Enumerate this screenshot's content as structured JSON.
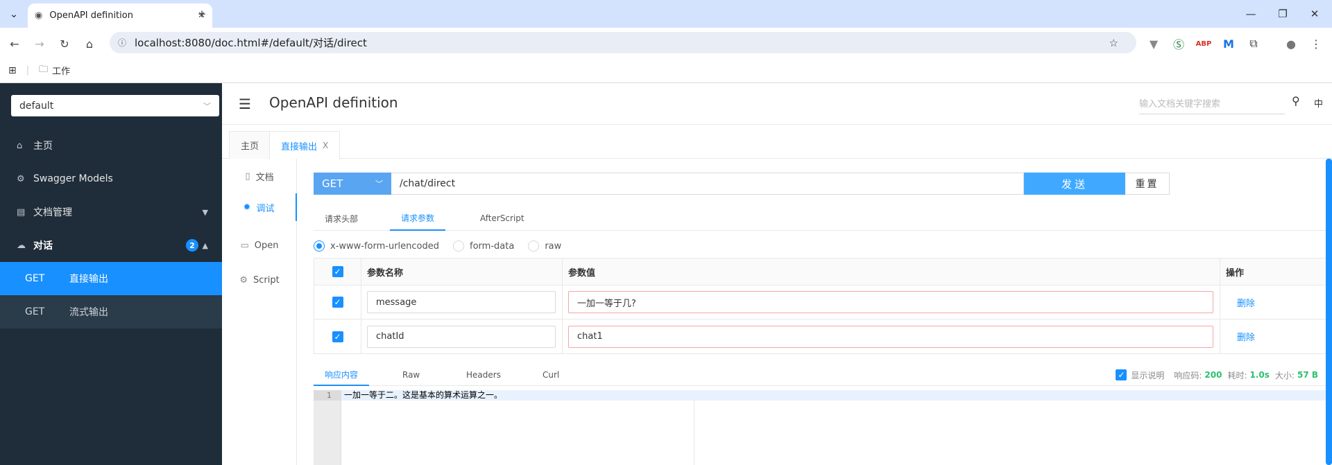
{
  "browser": {
    "tab_title": "OpenAPI definition",
    "url": "localhost:8080/doc.html#/default/对话/direct",
    "bookmark_folder": "工作"
  },
  "sidebar": {
    "group_select": "default",
    "items": [
      {
        "icon": "home-icon",
        "label": "主页"
      },
      {
        "icon": "models-icon",
        "label": "Swagger Models"
      },
      {
        "icon": "doc-manage-icon",
        "label": "文档管理"
      },
      {
        "icon": "cloud-icon",
        "label": "对话",
        "badge": "2"
      }
    ],
    "apis": [
      {
        "method": "GET",
        "name": "直接输出"
      },
      {
        "method": "GET",
        "name": "流式输出"
      }
    ]
  },
  "header": {
    "title": "OpenAPI definition",
    "search_placeholder": "输入文档关键字搜索",
    "lang": "中"
  },
  "doc_tabs": [
    {
      "label": "主页"
    },
    {
      "label": "直接输出",
      "close": "X"
    }
  ],
  "side_menu": [
    {
      "icon": "doc-icon",
      "label": "文档"
    },
    {
      "icon": "bug-icon",
      "label": "调试"
    },
    {
      "icon": "file-icon",
      "label": "Open"
    },
    {
      "icon": "script-icon",
      "label": "Script"
    }
  ],
  "request": {
    "method": "GET",
    "path": "/chat/direct",
    "send_label": "发送",
    "reset_label": "重置"
  },
  "sub_tabs": [
    "请求头部",
    "请求参数",
    "AfterScript"
  ],
  "body_types": [
    "x-www-form-urlencoded",
    "form-data",
    "raw"
  ],
  "params": {
    "headers": [
      "参数名称",
      "参数值",
      "操作"
    ],
    "rows": [
      {
        "name": "message",
        "value": "一加一等于几?",
        "action": "删除"
      },
      {
        "name": "chatId",
        "value": "chat1",
        "action": "删除"
      }
    ]
  },
  "response": {
    "tabs": [
      "响应内容",
      "Raw",
      "Headers",
      "Curl"
    ],
    "show_desc_label": "显示说明",
    "code_label": "响应码:",
    "code": "200",
    "time_label": "耗时:",
    "time": "1.0s",
    "size_label": "大小:",
    "size": "57 B",
    "line_no": "1",
    "body": "一加一等于二。这是基本的算术运算之一。"
  },
  "colors": {
    "accent": "#1890ff",
    "sidebar_bg": "#1f2d3a",
    "method_bg": "#5aa5f2",
    "success": "#2cbf6e"
  }
}
